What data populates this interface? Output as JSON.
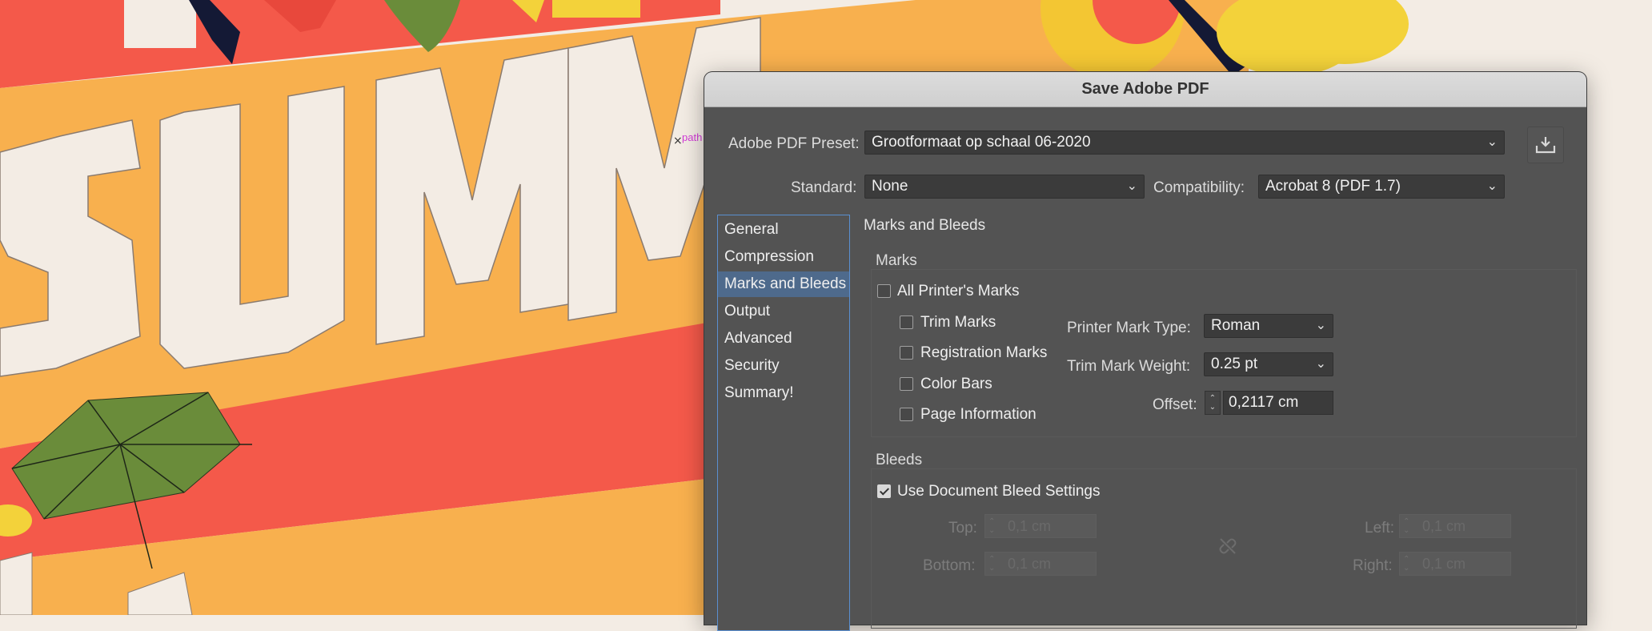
{
  "artwork": {
    "path_label": "path"
  },
  "dialog": {
    "title": "Save Adobe PDF",
    "preset": {
      "label": "Adobe PDF Preset:",
      "value": "Grootformaat op schaal 06-2020"
    },
    "standard": {
      "label": "Standard:",
      "value": "None"
    },
    "compatibility": {
      "label": "Compatibility:",
      "value": "Acrobat 8 (PDF 1.7)"
    },
    "sidebar": {
      "items": [
        {
          "label": "General"
        },
        {
          "label": "Compression"
        },
        {
          "label": "Marks and Bleeds"
        },
        {
          "label": "Output"
        },
        {
          "label": "Advanced"
        },
        {
          "label": "Security"
        },
        {
          "label": "Summary!"
        }
      ],
      "active": "Marks and Bleeds"
    },
    "panel_title": "Marks and Bleeds",
    "marks": {
      "title": "Marks",
      "all_printers_marks": {
        "label": "All Printer's Marks",
        "checked": false
      },
      "trim_marks": {
        "label": "Trim Marks",
        "checked": false
      },
      "registration_marks": {
        "label": "Registration Marks",
        "checked": false
      },
      "color_bars": {
        "label": "Color Bars",
        "checked": false
      },
      "page_information": {
        "label": "Page Information",
        "checked": false
      },
      "printer_mark_type": {
        "label": "Printer Mark Type:",
        "value": "Roman"
      },
      "trim_mark_weight": {
        "label": "Trim Mark Weight:",
        "value": "0.25 pt"
      },
      "offset": {
        "label": "Offset:",
        "value": "0,2117 cm"
      }
    },
    "bleeds": {
      "title": "Bleeds",
      "use_document_bleed": {
        "label": "Use Document Bleed Settings",
        "checked": true
      },
      "top": {
        "label": "Top:",
        "value": "0,1 cm"
      },
      "bottom": {
        "label": "Bottom:",
        "value": "0,1 cm"
      },
      "left": {
        "label": "Left:",
        "value": "0,1 cm"
      },
      "right": {
        "label": "Right:",
        "value": "0,1 cm"
      }
    },
    "colors": {
      "sidebar_active": "#4e6a8c",
      "sidebar_border": "#5a8fd0",
      "dialog_bg": "#535353"
    }
  }
}
